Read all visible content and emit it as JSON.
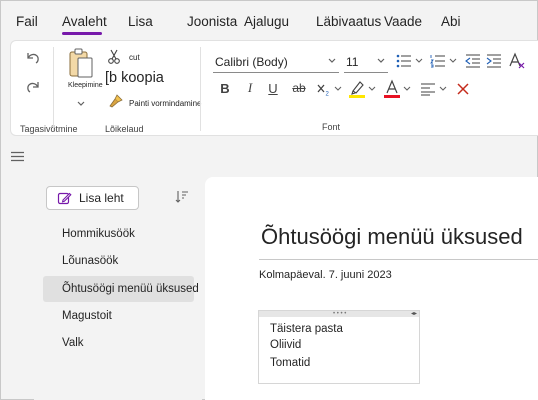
{
  "menu": {
    "tabs": [
      {
        "label": "Fail"
      },
      {
        "label": "Avaleht"
      },
      {
        "label": "Lisa"
      },
      {
        "label": "Joonista"
      },
      {
        "label": "Ajalugu"
      },
      {
        "label": "Läbivaatus"
      },
      {
        "label": "Vaade"
      },
      {
        "label": "Abi"
      }
    ],
    "active_tab": "Avaleht",
    "accent_color": "#7719aa"
  },
  "ribbon": {
    "undo_group": {
      "label": "Tagasivõtmine"
    },
    "clipboard": {
      "label": "Lõikelaud",
      "paste_label": "Kleepimine",
      "cut_label": "cut",
      "copy_label": "[b koopia",
      "format_painter_label": "Painti vormindamine"
    },
    "font": {
      "label": "Font",
      "font_name": "Calibri (Body)",
      "font_size": "11",
      "highlight_color": "#ffe600",
      "font_color": "#e81123"
    }
  },
  "pages": {
    "add_label": "Lisa leht",
    "items": [
      {
        "label": "Hommikusöök"
      },
      {
        "label": "Lõunasöök"
      },
      {
        "label": "Õhtusöögi menüü üksused"
      },
      {
        "label": "Magustoit"
      },
      {
        "label": "Valk"
      }
    ],
    "selected_index": 2
  },
  "page": {
    "title": "Õhtusöögi menüü üksused",
    "date": "Kolmapäeval. 7. juuni 2023",
    "note_lines": [
      "Täistera pasta",
      "Oliivid",
      "Tomatid"
    ]
  }
}
